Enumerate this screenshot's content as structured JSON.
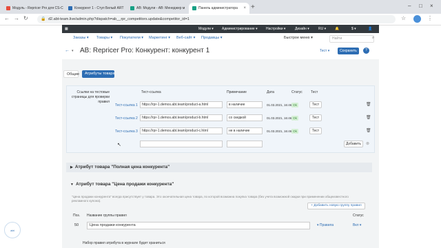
{
  "browser": {
    "tabs": [
      {
        "title": "Модуль - Repricer Pro для CS-C",
        "color": "#e74c3c"
      },
      {
        "title": "Конкурент 1 - Стул Белый ART",
        "color": "#2d6db3"
      },
      {
        "title": "AB: Модули - AB: Менеджер м",
        "color": "#16a085"
      },
      {
        "title": "Панель администратора",
        "color": "#16a085"
      }
    ],
    "url": "d2.abt-team.live/admin.php?dispatch=ab__rpr_competitors.update&competitor_id=1"
  },
  "topnav": {
    "modules": "Модули ▾",
    "administration": "Администрирование ▾",
    "settings": "Настройки ▾",
    "design": "Дизайн ▾",
    "lang": "RU ▾",
    "currency": "$ ▾"
  },
  "menu": {
    "items": [
      "Заказы ▾",
      "Товары ▾",
      "Покупатели ▾",
      "Маркетинг ▾",
      "Веб-сайт ▾",
      "Продавцы ▾"
    ],
    "quick_menu": "Быстрое меню ▾",
    "search_placeholder": "Найти"
  },
  "page": {
    "title": "AB: Repricer Pro: Конкурент: конкурент 1",
    "test_dropdown": "Тест ▾",
    "save": "Сохранить"
  },
  "tabs": {
    "general": "Общие",
    "attributes": "Атрибуты товара"
  },
  "links_table": {
    "left_label": "Ссылки на тестовые страницы для проверки правил",
    "headers": {
      "link": "Тест-ссылка",
      "note": "Примечание",
      "date": "Дата",
      "status": "Статус",
      "test": "Тест"
    },
    "rows": [
      {
        "label": "Тест-ссылка 1",
        "url": "https://rpr-1.demos.abt.team/product-a.html",
        "note": "в наличие",
        "date": "01.03.2021, 16:46",
        "status": "Ok",
        "test": "Тест"
      },
      {
        "label": "Тест-ссылка 2",
        "url": "https://rpr-1.demos.abt.team/product-b.html",
        "note": "со скидкой",
        "date": "01.03.2021, 16:46",
        "status": "Ok",
        "test": "Тест"
      },
      {
        "label": "Тест-ссылка 3",
        "url": "https://rpr-1.demos.abt.team/product-c.html",
        "note": "не в наличие",
        "date": "01.03.2021, 16:46",
        "status": "Ok",
        "test": "Тест"
      }
    ],
    "add_button": "Добавить"
  },
  "sections": {
    "full_price": "Атрибут товара \"Полная цена конкурента\"",
    "sale_price": "Атрибут товара \"Цена продажи конкурента\"",
    "sale_desc": "\"Цена продажи конкурента\" всегда присутствует у товара. Это окончательная цена товара, по которой возможна покупка товара (без учета возможной скидки при применении общеизвестного рекламного купона).",
    "add_group": "+ Добавить новую группу правил"
  },
  "groups": {
    "headers": {
      "pos": "Поз.",
      "name": "Название группы правил",
      "status": "Статус"
    },
    "row": {
      "pos": "50",
      "name": "Цена продажи конкурента",
      "rules": "▾ Правила",
      "status": "Вкл ▾"
    },
    "next_label": "Набор правил атрибута в журнале будет храниться"
  }
}
